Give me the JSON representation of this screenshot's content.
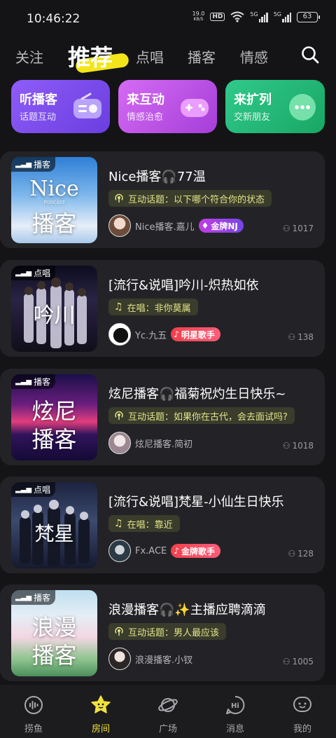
{
  "status": {
    "time": "10:46:22",
    "net_speed": "19.0",
    "net_unit": "KB/S",
    "hd": "HD",
    "sig1": "5G",
    "sig2": "5G",
    "battery": "63"
  },
  "tabs": [
    "关注",
    "推荐",
    "点唱",
    "播客",
    "情感"
  ],
  "quick": [
    {
      "title": "听播客",
      "subtitle": "话题互动",
      "icon": "radio-icon",
      "color": "#7d4df0"
    },
    {
      "title": "来互动",
      "subtitle": "情感治愈",
      "icon": "gamepad-icon",
      "color": "#c457ec"
    },
    {
      "title": "来扩列",
      "subtitle": "交新朋友",
      "icon": "chat-bubble-icon",
      "color": "#25b878"
    }
  ],
  "rooms": [
    {
      "tag": "播客",
      "cover_text": [
        "Nice",
        "播客"
      ],
      "cover_sub": "PODCAST",
      "title": "Nice播客🎧77温",
      "topic_label": "互动话题：以下哪个符合你的状态",
      "host": "Nice播客.嘉儿",
      "badge": "金牌NJ",
      "count": "1017"
    },
    {
      "tag": "点唱",
      "cover_text": [
        "吟川"
      ],
      "title": "[流行&说唱]吟川-炽热如依",
      "topic_label": "在唱：非你莫属",
      "host": "Yc.九五",
      "badge": "明星歌手",
      "count": "138"
    },
    {
      "tag": "播客",
      "cover_text": [
        "炫尼",
        "播客"
      ],
      "title": "炫尼播客🎧福菊祝灼生日快乐~",
      "topic_label": "互动话题：如果你在古代，会去面试吗?",
      "host": "炫尼播客.简初",
      "badge": "",
      "count": "1018"
    },
    {
      "tag": "点唱",
      "cover_text": [
        "梵星"
      ],
      "title": "[流行&说唱]梵星-小仙生日快乐",
      "topic_label": "在唱：靠近",
      "host": "Fx.ACE",
      "badge": "金牌歌手",
      "count": "128"
    },
    {
      "tag": "播客",
      "cover_text": [
        "浪漫",
        "播客"
      ],
      "title": "浪漫播客🎧✨主播应聘滴滴",
      "topic_label": "互动话题：男人最应该",
      "host": "浪漫播客.小钗",
      "badge": "",
      "count": "1005"
    }
  ],
  "bottom_nav": [
    "捞鱼",
    "房间",
    "广场",
    "消息",
    "我的"
  ],
  "colors": {
    "accent": "#f0e23c",
    "background": "#141416",
    "card": "#232327"
  }
}
